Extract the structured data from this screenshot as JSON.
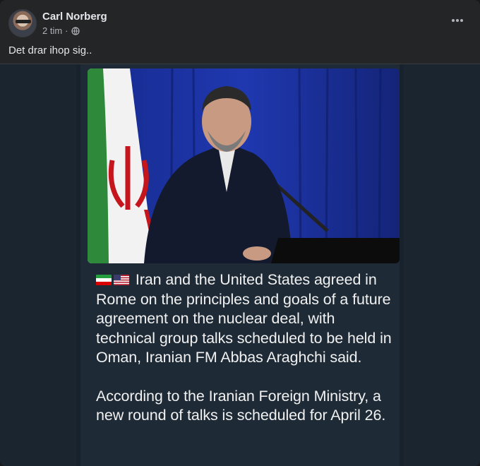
{
  "post": {
    "author": "Carl Norberg",
    "time": "2 tim",
    "separator": "·",
    "text": "Det drar ihop sig..",
    "privacy_icon": "globe-icon",
    "more_icon": "more-options-icon"
  },
  "image": {
    "paragraph1": "Iran and the United States agreed in Rome on the principles and goals of a future agreement on the nuclear deal, with technical group talks scheduled to be held in Oman, Iranian FM Abbas Araghchi said.",
    "paragraph2": "According to the Iranian Foreign Ministry, a new round of talks is scheduled for April 26.",
    "flags": [
      "iran-flag-icon",
      "us-flag-icon"
    ]
  },
  "colors": {
    "background": "#242526",
    "text": "#e4e6eb",
    "muted": "#b0b3b8",
    "curtain": "#1a2a8a"
  }
}
